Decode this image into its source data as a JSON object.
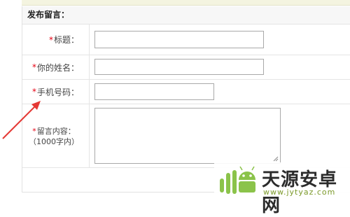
{
  "form": {
    "header": "发布留言：",
    "required_mark": "*",
    "fields": {
      "title": {
        "label": "标题：",
        "value": ""
      },
      "name": {
        "label": "你的姓名：",
        "value": ""
      },
      "phone": {
        "label": "手机号码：",
        "value": ""
      },
      "message": {
        "label": "留言内容：",
        "hint": "（1000字内）",
        "value": ""
      }
    }
  },
  "watermark": {
    "title": "天源安卓网",
    "url": "www.jytyaz.com"
  },
  "colors": {
    "required": "#e60012",
    "arrow": "#e53935",
    "watermark_green": "#8bc34a"
  }
}
